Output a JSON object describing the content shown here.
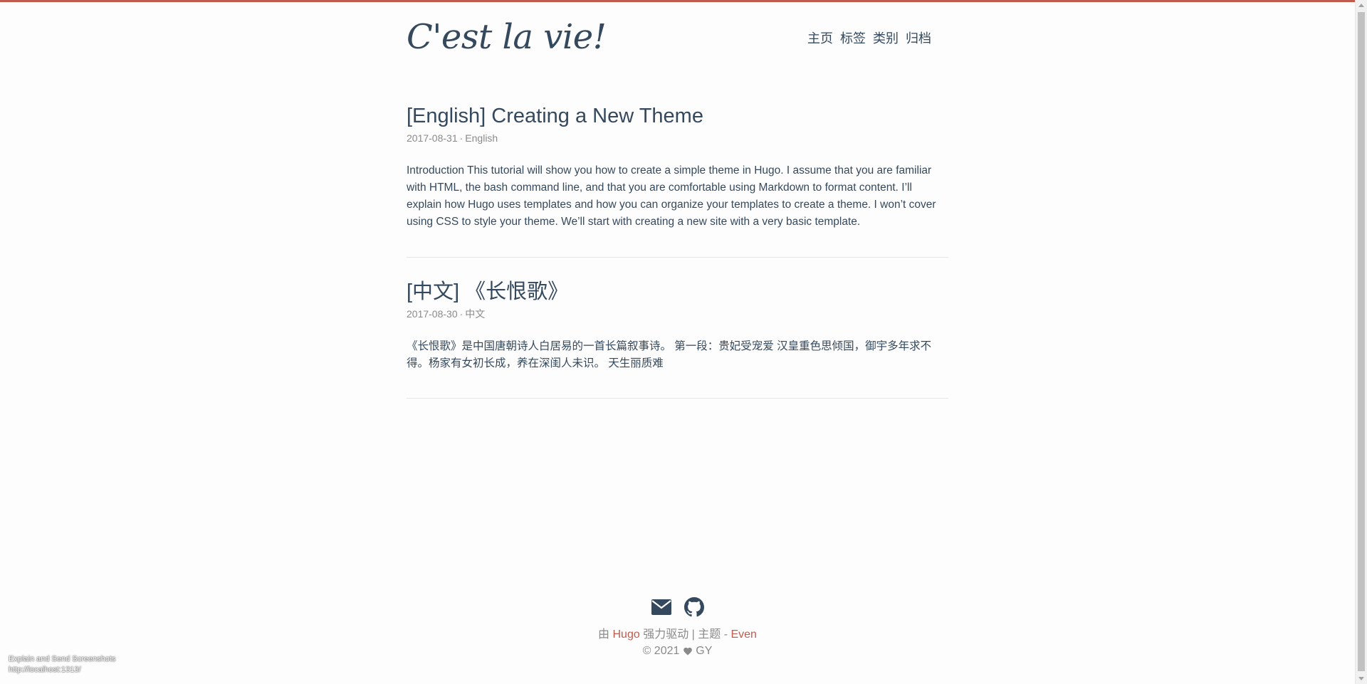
{
  "site": {
    "logo": "C'est la vie!"
  },
  "nav": {
    "items": [
      {
        "label": "主页"
      },
      {
        "label": "标签"
      },
      {
        "label": "类别"
      },
      {
        "label": "归档"
      }
    ]
  },
  "posts": [
    {
      "title": "[English] Creating a New Theme",
      "date": "2017-08-31",
      "category": "English",
      "summary": "Introduction This tutorial will show you how to create a simple theme in Hugo. I assume that you are familiar with HTML, the bash command line, and that you are comfortable using Markdown to format content. I’ll explain how Hugo uses templates and how you can organize your templates to create a theme. I won’t cover using CSS to style your theme. We’ll start with creating a new site with a very basic template."
    },
    {
      "title": "[中文] 《长恨歌》",
      "date": "2017-08-30",
      "category": "中文",
      "summary": "《长恨歌》是中国唐朝诗人白居易的一首长篇叙事诗。 第一段：贵妃受宠爱 汉皇重色思倾国，御宇多年求不得。杨家有女初长成，养在深闺人未识。 天生丽质难"
    }
  ],
  "footer": {
    "social": [
      {
        "icon": "email-icon"
      },
      {
        "icon": "github-icon"
      }
    ],
    "powered_prefix": "由",
    "powered_link": "Hugo",
    "powered_middle": "强力驱动 | 主题 -",
    "theme_link": "Even",
    "copyright_prefix": "© 2021",
    "copyright_author": "GY"
  },
  "overlay": {
    "line1": "Explain and Send Screenshots",
    "line2": "http://localhost:1313/"
  },
  "colors": {
    "accent": "#c05b4d",
    "text": "#34495e",
    "meta": "#8a8a8a"
  }
}
